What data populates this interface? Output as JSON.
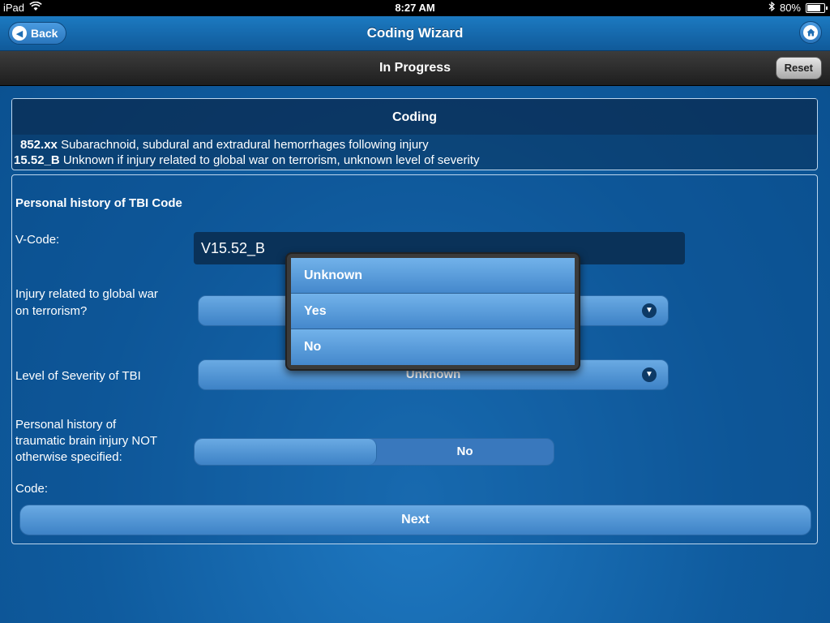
{
  "statusbar": {
    "device": "iPad",
    "time": "8:27 AM",
    "battery": "80%",
    "battery_level": 0.8
  },
  "navbar": {
    "back_label": "Back",
    "title": "Coding Wizard"
  },
  "subbar": {
    "title": "In Progress",
    "reset_label": "Reset"
  },
  "coding": {
    "header": "Coding",
    "lines": [
      {
        "code": "852.xx",
        "description": "Subarachnoid, subdural and extradural hemorrhages following injury"
      },
      {
        "code": "15.52_B",
        "description": "Unknown if injury related to global war on terrorism, unknown level of severity"
      }
    ]
  },
  "form": {
    "section_title": "Personal history of TBI Code",
    "vcode_label": "V-Code:",
    "vcode_value": "V15.52_B",
    "gwot_label_1": "Injury related to global war",
    "gwot_label_2": "on terrorism?",
    "severity_label": "Level of Severity of TBI",
    "severity_value": "Unknown",
    "nos_label_1": "Personal history of",
    "nos_label_2": "traumatic brain injury NOT",
    "nos_label_3": "otherwise specified:",
    "nos_value": "No",
    "code_label": "Code:",
    "next_label": "Next"
  },
  "popup": {
    "options": [
      "Unknown",
      "Yes",
      "No"
    ]
  }
}
